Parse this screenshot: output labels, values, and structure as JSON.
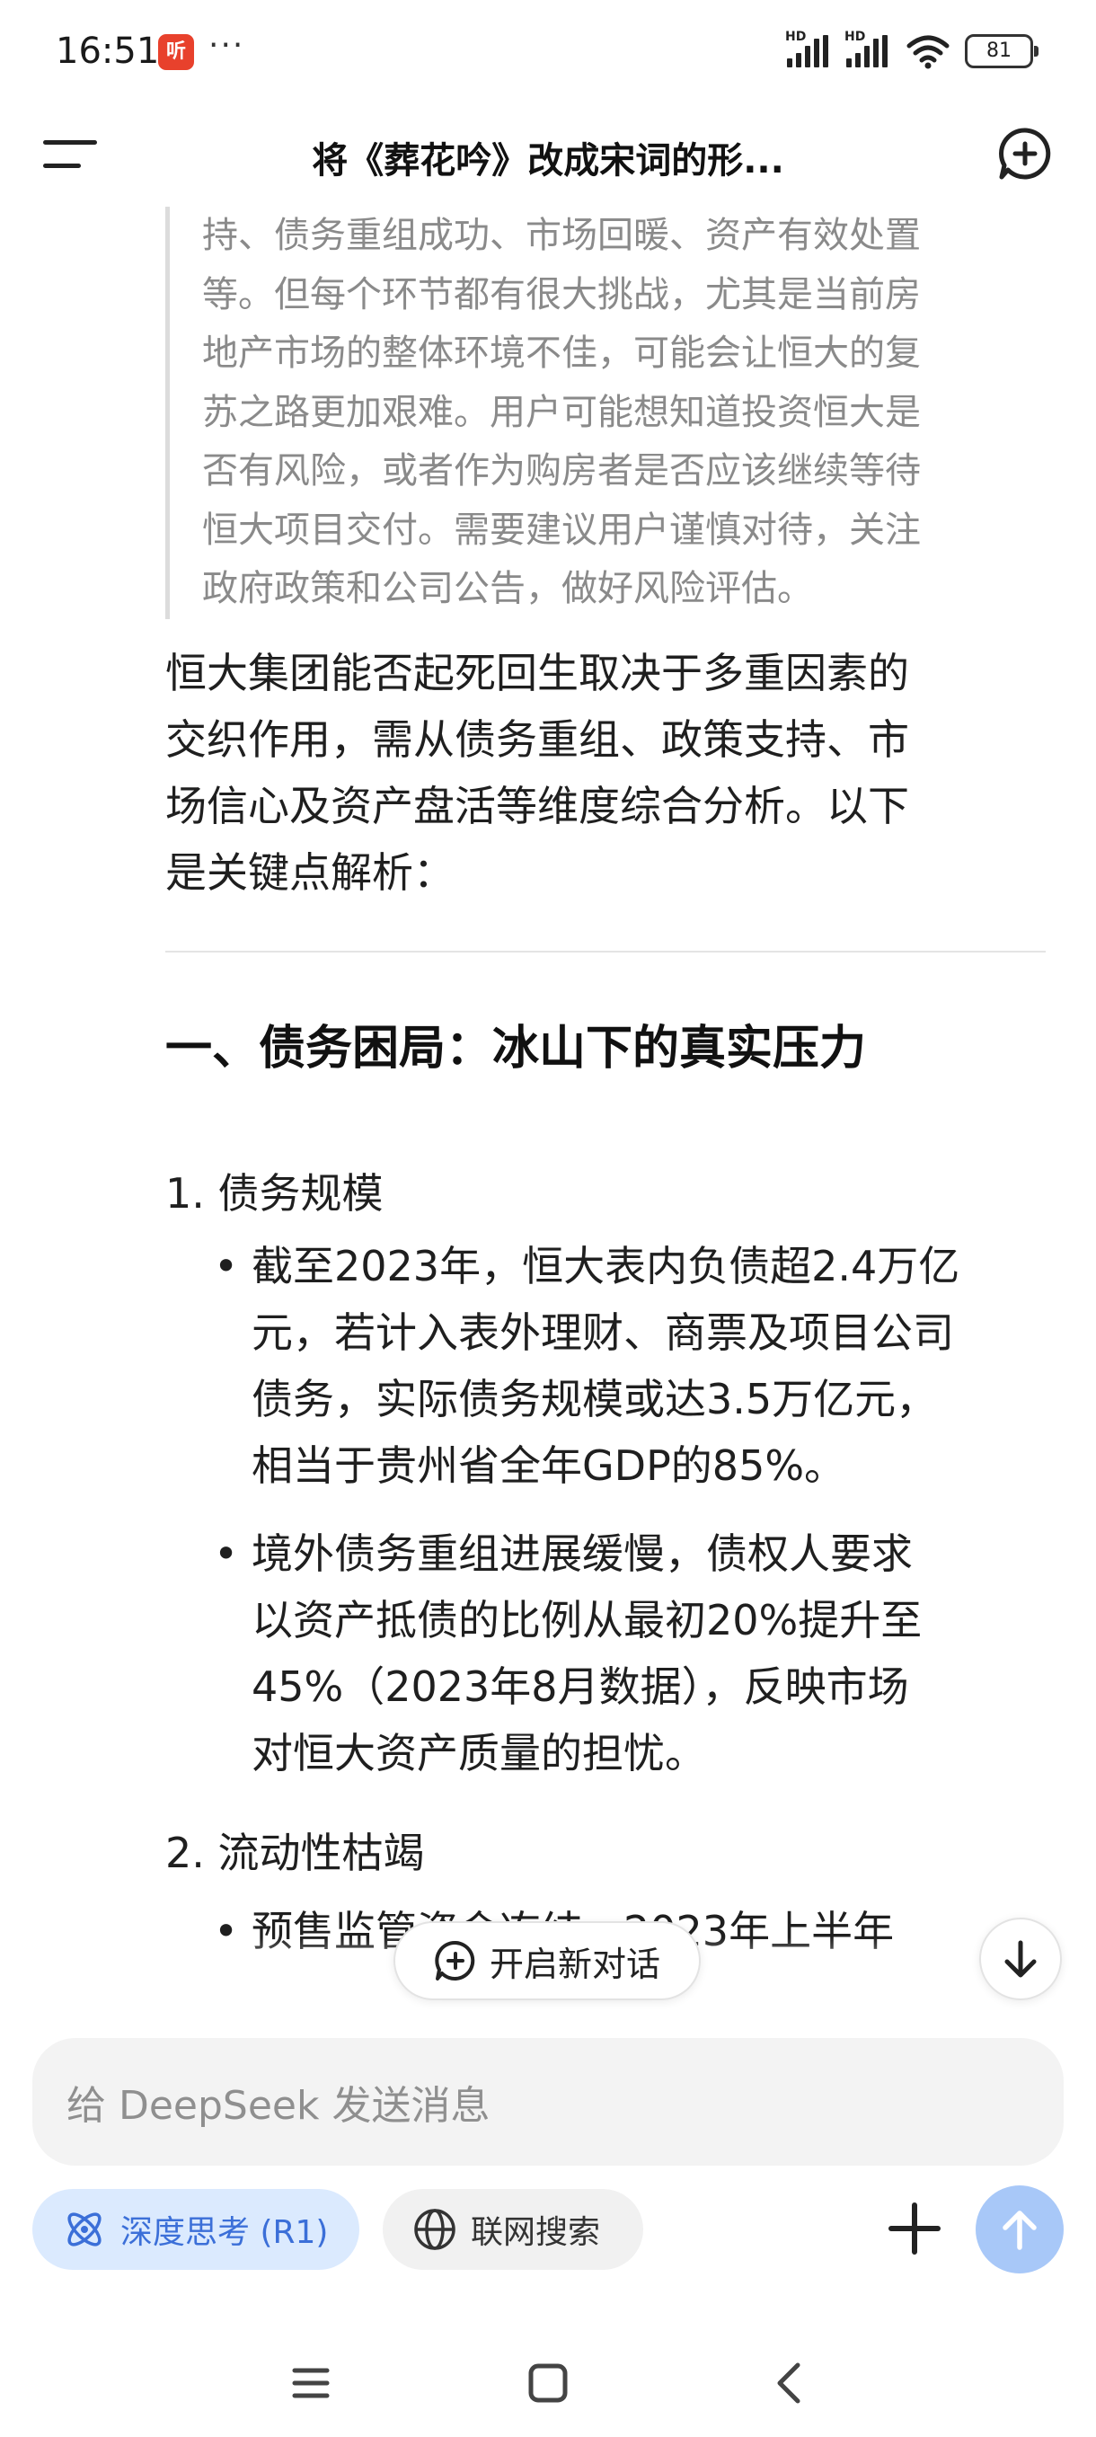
{
  "status_bar": {
    "time": "16:51",
    "app_badge": "听",
    "more": "···",
    "signal1_label": "HD",
    "signal2_label": "HD",
    "battery": "81"
  },
  "header": {
    "title": "将《葬花吟》改成宋词的形..."
  },
  "conversation": {
    "thinking_lines": [
      "持、债务重组成功、市场回暖、资产有效处置",
      "等。但每个环节都有很大挑战，尤其是当前房",
      "地产市场的整体环境不佳，可能会让恒大的复",
      "苏之路更加艰难。用户可能想知道投资恒大是",
      "否有风险，或者作为购房者是否应该继续等待",
      "恒大项目交付。需要建议用户谨慎对待，关注",
      "政府政策和公司公告，做好风险评估。"
    ],
    "intro_lines": [
      "恒大集团能否起死回生取决于多重因素的",
      "交织作用，需从债务重组、政策支持、市",
      "场信心及资产盘活等维度综合分析。以下",
      "是关键点解析："
    ],
    "section_title": "一、债务困局：冰山下的真实压力",
    "list": [
      {
        "label": "1. 债务规模",
        "bullets": [
          [
            "截至2023年，恒大表内负债超2.4万亿",
            "元，若计入表外理财、商票及项目公司",
            "债务，实际债务规模或达3.5万亿元，",
            "相当于贵州省全年GDP的85%。"
          ],
          [
            "境外债务重组进展缓慢，债权人要求",
            "以资产抵债的比例从最初20%提升至",
            "45%（2023年8月数据），反映市场",
            "对恒大资产质量的担忧。"
          ]
        ]
      },
      {
        "label": "2. 流动性枯竭",
        "bullets": [
          [
            "预售监管资金冻结，2023年上半年"
          ]
        ]
      }
    ]
  },
  "overlay": {
    "new_conversation_label": "开启新对话"
  },
  "composer": {
    "placeholder": "给 DeepSeek 发送消息",
    "deep_think_label": "深度思考 (R1)",
    "web_search_label": "联网搜索"
  },
  "colors": {
    "accent": "#3b6fd8",
    "deep_think_bg": "#dbeafe",
    "send_button": "#a8c8f8"
  }
}
